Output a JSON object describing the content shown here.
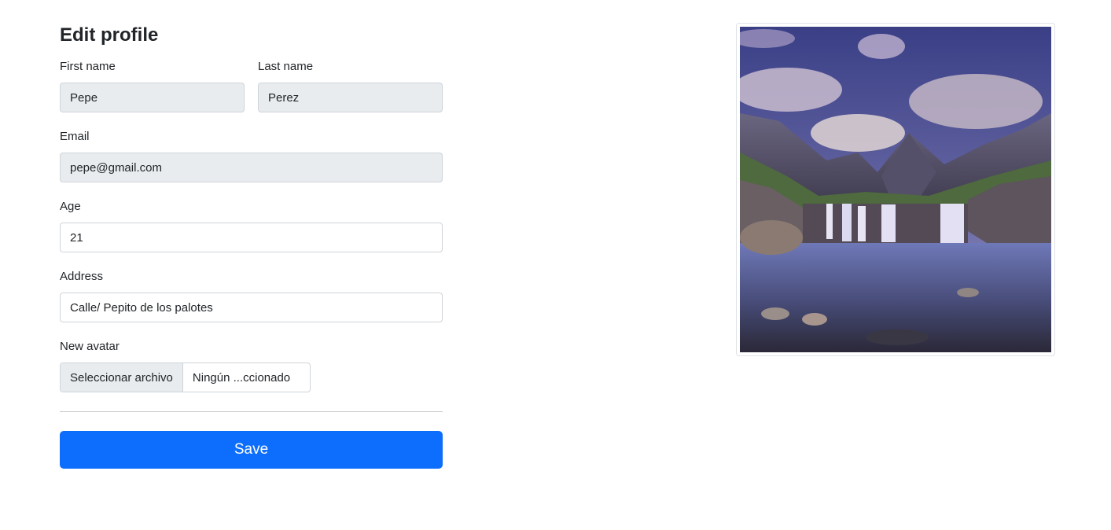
{
  "form": {
    "title": "Edit profile",
    "first_name": {
      "label": "First name",
      "value": "Pepe"
    },
    "last_name": {
      "label": "Last name",
      "value": "Perez"
    },
    "email": {
      "label": "Email",
      "value": "pepe@gmail.com"
    },
    "age": {
      "label": "Age",
      "value": "21"
    },
    "address": {
      "label": "Address",
      "value": "Calle/ Pepito de los palotes"
    },
    "avatar": {
      "label": "New avatar",
      "button_label": "Seleccionar archivo",
      "file_name": "Ningún ...ccionado"
    },
    "save_label": "Save"
  },
  "colors": {
    "primary": "#0d6efd",
    "readonly_bg": "#e9ecef",
    "border": "#ced4da"
  },
  "image": {
    "subject": "waterfall-landscape-image"
  }
}
